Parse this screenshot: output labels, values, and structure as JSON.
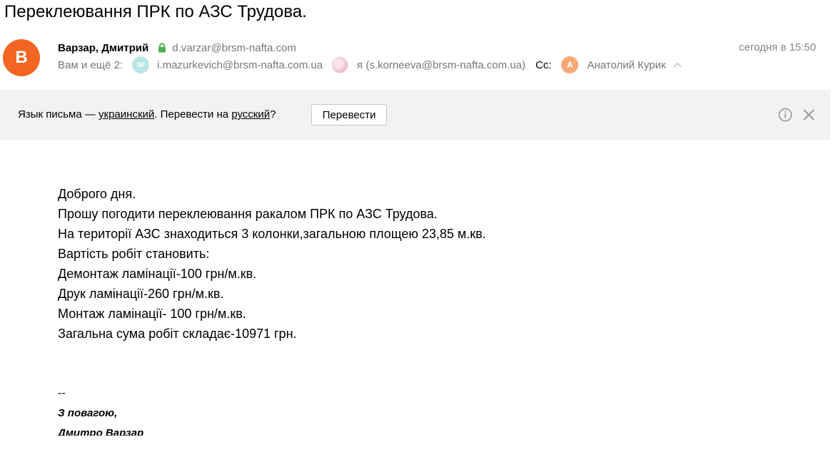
{
  "subject": "Переклеювання ПРК по АЗС Трудова.",
  "sender": {
    "avatar_letter": "B",
    "avatar_color": "#f26522",
    "name": "Варзар, Дмитрий",
    "email": "d.varzar@brsm-nafta.com",
    "date": "сегодня в 15:50"
  },
  "recipients": {
    "prefix": "Вам и ещё 2:",
    "items": [
      {
        "avatar": "IM",
        "label": "i.mazurkevich@brsm-nafta.com.ua"
      },
      {
        "avatar": "",
        "label": "я (s.korneeva@brsm-nafta.com.ua)"
      }
    ],
    "cc_label": "Cc:",
    "cc_avatar": "А",
    "cc_name": "Анатолий Курик"
  },
  "translate": {
    "text_prefix": "Язык письма — ",
    "source_lang": "украинский",
    "text_middle": ". Перевести на ",
    "target_lang": "русский",
    "text_suffix": "?",
    "button": "Перевести"
  },
  "body": {
    "lines": [
      "Доброго дня.",
      "Прошу погодити переклеювання ракалом  ПРК по АЗС Трудова.",
      "На території АЗС знаходиться 3 колонки,загальною площею 23,85 м.кв.",
      "Вартість робіт становить:",
      "Демонтаж ламінації-100 грн/м.кв.",
      "Друк ламінації-260 грн/м.кв.",
      "Монтаж ламінації- 100 грн/м.кв.",
      "Загальна сума робіт складає-10971 грн."
    ],
    "signature_dash": "--",
    "signature_lines": [
      "З повагою,",
      "Дмитро Варзар"
    ]
  },
  "icons": {
    "lock": "lock-icon",
    "chevron": "chevron-up-icon",
    "info": "info-icon",
    "close": "close-icon"
  },
  "colors": {
    "accent_green": "#4caf50",
    "bar_bg": "#f2f2f2",
    "muted_text": "#777777"
  }
}
